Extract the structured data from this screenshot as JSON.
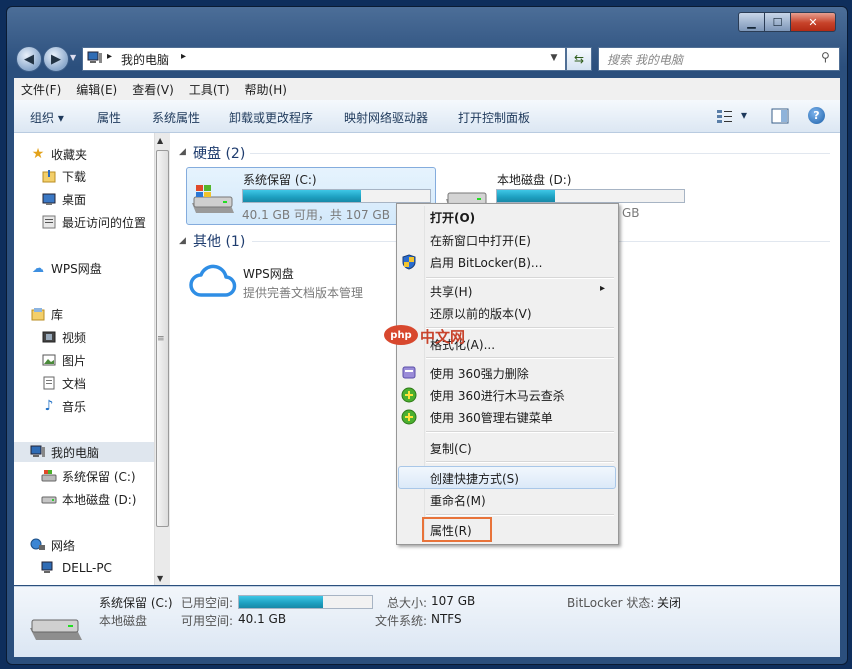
{
  "window": {
    "controls": {
      "minimize": "▁",
      "maximize": "☐",
      "close": "✕"
    }
  },
  "address": {
    "crumbs": [
      "我的电脑"
    ],
    "separator": "▸",
    "dropdown": "▼"
  },
  "search": {
    "placeholder": "搜索 我的电脑"
  },
  "menubar": [
    "文件(F)",
    "编辑(E)",
    "查看(V)",
    "工具(T)",
    "帮助(H)"
  ],
  "toolbar": {
    "organize": "组织 ▾",
    "items": [
      "属性",
      "系统属性",
      "卸载或更改程序",
      "映射网络驱动器",
      "打开控制面板"
    ],
    "view_arrow": "▾",
    "help": "?"
  },
  "nav": {
    "favorites": "收藏夹",
    "fav_items": [
      "下载",
      "桌面",
      "最近访问的位置"
    ],
    "wps": "WPS网盘",
    "library": "库",
    "lib_items": [
      "视频",
      "图片",
      "文档",
      "音乐"
    ],
    "computer": "我的电脑",
    "computer_items": [
      "系统保留 (C:)",
      "本地磁盘 (D:)"
    ],
    "network": "网络",
    "network_items": [
      "DELL-PC"
    ]
  },
  "content": {
    "hdd_group": "硬盘 (2)",
    "other_group": "其他 (1)",
    "drive_c": {
      "name": "系统保留 (C:)",
      "detail": "40.1 GB 可用，共 107 GB",
      "used_fraction": 0.63
    },
    "drive_d": {
      "name": "本地磁盘 (D:)",
      "detail_tail": "GB",
      "used_fraction": 0.31
    },
    "wps": {
      "name": "WPS网盘",
      "desc": "提供完善文档版本管理"
    }
  },
  "context_menu": {
    "open": "打开(O)",
    "open_new": "在新窗口中打开(E)",
    "bitlocker": "启用 BitLocker(B)...",
    "share": "共享(H)",
    "restore": "还原以前的版本(V)",
    "format": "格式化(A)...",
    "del360": "使用 360强力删除",
    "scan360": "使用 360进行木马云查杀",
    "manage360": "使用 360管理右键菜单",
    "copy": "复制(C)",
    "shortcut": "创建快捷方式(S)",
    "rename": "重命名(M)",
    "properties": "属性(R)",
    "submenu_arrow": "▸"
  },
  "watermark": "中文网",
  "watermark_logo": "php",
  "status": {
    "name": "系统保留 (C:)",
    "type": "本地磁盘",
    "used_label": "已用空间:",
    "free_label": "可用空间:",
    "free_value": "40.1 GB",
    "total_label": "总大小:",
    "total_value": "107 GB",
    "fs_label": "文件系统:",
    "fs_value": "NTFS",
    "bitlocker_label": "BitLocker 状态:",
    "bitlocker_value": "关闭",
    "used_fraction": 0.63
  },
  "colors": {
    "accent": "#1e3c6e",
    "highlight_border": "#e8733a",
    "selection": "#cce8ff"
  }
}
